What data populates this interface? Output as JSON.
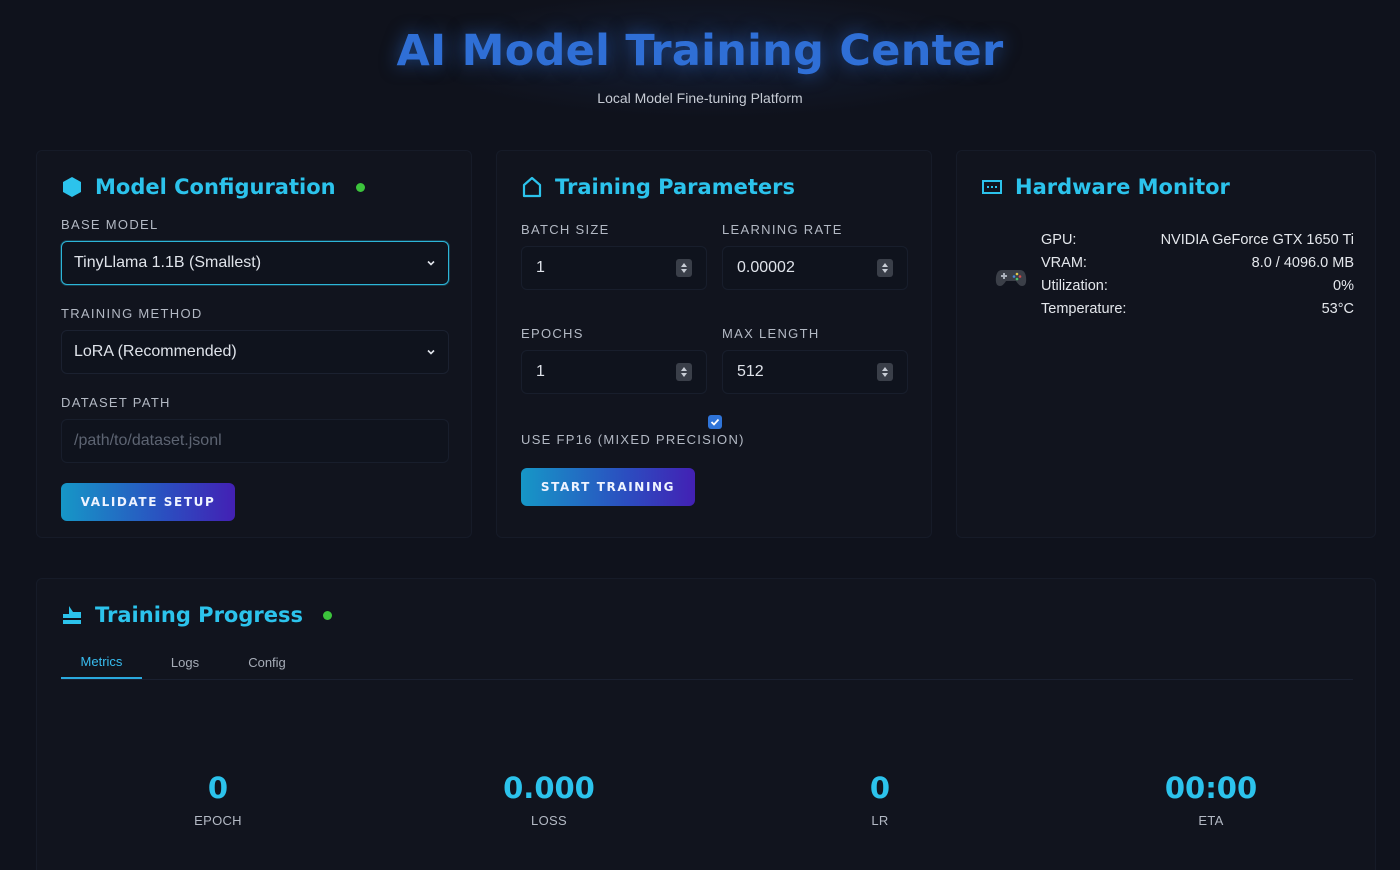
{
  "header": {
    "title": "AI Model Training Center",
    "subtitle": "Local Model Fine-tuning Platform"
  },
  "colors": {
    "accent": "#2cc3ec",
    "title": "#2f6fd6",
    "status_ok": "#3cc43c",
    "background": "#0f121c"
  },
  "model_config": {
    "title": "Model Configuration",
    "icon": "hexagon-icon",
    "base_model_label": "Base Model",
    "base_model_value": "TinyLlama 1.1B (Smallest)",
    "training_method_label": "Training Method",
    "training_method_value": "LoRA (Recommended)",
    "dataset_path_label": "Dataset Path",
    "dataset_path_placeholder": "/path/to/dataset.jsonl",
    "validate_button": "Validate Setup"
  },
  "training_params": {
    "title": "Training Parameters",
    "icon": "home-icon",
    "batch_size_label": "Batch Size",
    "batch_size_value": "1",
    "learning_rate_label": "Learning Rate",
    "learning_rate_value": "0.00002",
    "epochs_label": "Epochs",
    "epochs_value": "1",
    "max_length_label": "Max Length",
    "max_length_value": "512",
    "fp16_label": "Use FP16 (Mixed Precision)",
    "fp16_checked": true,
    "start_button": "Start Training"
  },
  "hardware": {
    "title": "Hardware Monitor",
    "icon": "monitor-icon",
    "device_icon": "gamepad-icon",
    "rows": [
      {
        "key": "GPU:",
        "value": "NVIDIA GeForce GTX 1650 Ti"
      },
      {
        "key": "VRAM:",
        "value": "8.0 / 4096.0 MB"
      },
      {
        "key": "Utilization:",
        "value": "0%"
      },
      {
        "key": "Temperature:",
        "value": "53°C"
      }
    ]
  },
  "progress": {
    "title": "Training Progress",
    "icon": "chart-icon",
    "tabs": [
      "Metrics",
      "Logs",
      "Config"
    ],
    "active_tab": "Metrics",
    "metrics": [
      {
        "value": "0",
        "caption": "EPOCH"
      },
      {
        "value": "0.000",
        "caption": "LOSS"
      },
      {
        "value": "0",
        "caption": "LR"
      },
      {
        "value": "00:00",
        "caption": "ETA"
      }
    ]
  }
}
